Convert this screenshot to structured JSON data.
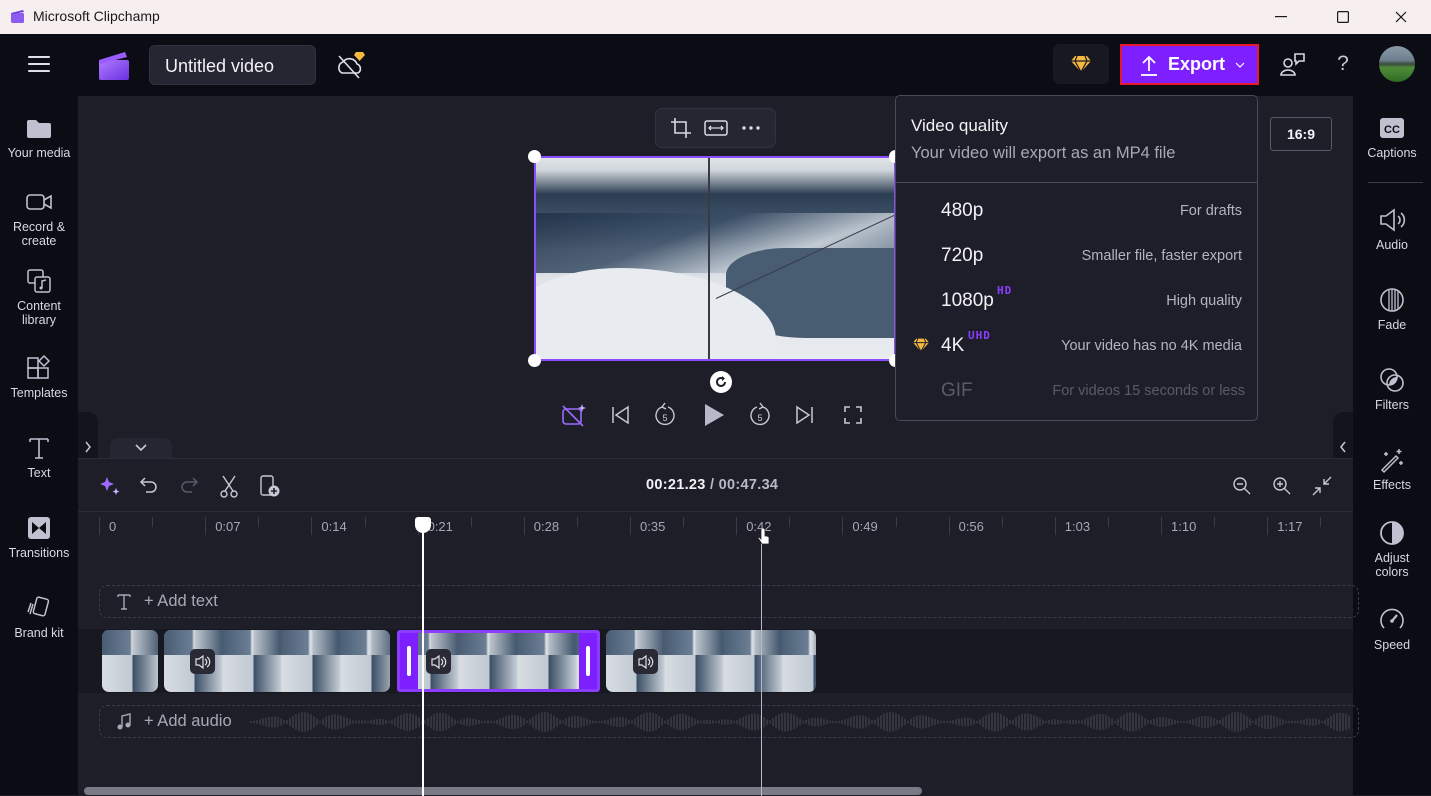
{
  "window": {
    "title": "Microsoft Clipchamp",
    "controls": [
      "minimize",
      "maximize",
      "close"
    ]
  },
  "header": {
    "menu_icon": "hamburger-icon",
    "project_title": "Untitled video",
    "sync_status_icon": "cloud-off-premium-icon",
    "premium_icon": "diamond-icon",
    "export_label": "Export",
    "share_icon": "share-feedback-icon",
    "help_label": "?",
    "avatar": "user-avatar"
  },
  "left_sidebar": {
    "items": [
      {
        "label": "Your media",
        "icon": "folder-icon"
      },
      {
        "label": "Record & create",
        "icon": "video-camera-icon"
      },
      {
        "label": "Content library",
        "icon": "content-library-icon"
      },
      {
        "label": "Templates",
        "icon": "templates-icon"
      },
      {
        "label": "Text",
        "icon": "text-icon"
      },
      {
        "label": "Transitions",
        "icon": "transitions-icon"
      },
      {
        "label": "Brand kit",
        "icon": "brand-kit-icon"
      }
    ]
  },
  "right_sidebar": {
    "items": [
      {
        "label": "Captions",
        "icon": "cc-icon"
      },
      {
        "label": "Audio",
        "icon": "speaker-icon"
      },
      {
        "label": "Fade",
        "icon": "fade-icon"
      },
      {
        "label": "Filters",
        "icon": "filters-icon"
      },
      {
        "label": "Effects",
        "icon": "magic-wand-icon"
      },
      {
        "label": "Adjust colors",
        "icon": "contrast-icon"
      },
      {
        "label": "Speed",
        "icon": "speedometer-icon"
      }
    ]
  },
  "stage": {
    "toolbar": [
      "crop-icon",
      "fit-icon",
      "more-icon"
    ],
    "aspect_ratio": "16:9",
    "playback": [
      "ai-camera-icon",
      "skip-back-icon",
      "rewind-5-icon",
      "play-icon",
      "forward-5-icon",
      "skip-forward-icon",
      "fullscreen-icon"
    ],
    "rewind_seconds": "5",
    "forward_seconds": "5"
  },
  "export_menu": {
    "title": "Video quality",
    "subtitle": "Your video will export as an MP4 file",
    "options": [
      {
        "label": "480p",
        "badge": "",
        "description": "For drafts",
        "premium": false,
        "disabled": false
      },
      {
        "label": "720p",
        "badge": "",
        "description": "Smaller file, faster export",
        "premium": false,
        "disabled": false
      },
      {
        "label": "1080p",
        "badge": "HD",
        "description": "High quality",
        "premium": false,
        "disabled": false
      },
      {
        "label": "4K",
        "badge": "UHD",
        "description": "Your video has no 4K media",
        "premium": true,
        "disabled": false
      },
      {
        "label": "GIF",
        "badge": "",
        "description": "For videos 15 seconds or less",
        "premium": false,
        "disabled": true
      }
    ]
  },
  "timeline": {
    "current_time": "00:21.23",
    "separator": " / ",
    "total_time": "00:47.34",
    "tools": [
      "magic-icon",
      "undo-icon",
      "redo-icon",
      "split-icon",
      "add-clip-icon"
    ],
    "zoom_tools": [
      "zoom-out-icon",
      "zoom-in-icon",
      "fit-timeline-icon"
    ],
    "ruler_labels": [
      "0",
      "0:07",
      "0:14",
      "0:21",
      "0:28",
      "0:35",
      "0:42",
      "0:49",
      "0:56",
      "1:03",
      "1:10",
      "1:17"
    ],
    "text_track_label": "+ Add text",
    "audio_track_label": "+ Add audio",
    "clips": [
      {
        "name": "clip-1",
        "has_audio": false,
        "selected": false
      },
      {
        "name": "clip-2",
        "has_audio": true,
        "selected": false
      },
      {
        "name": "clip-3",
        "has_audio": true,
        "selected": true
      },
      {
        "name": "clip-4",
        "has_audio": true,
        "selected": false
      }
    ]
  },
  "colors": {
    "accent": "#7d1fff",
    "selection": "#8b4dff",
    "export_border": "#e8192c",
    "premium_gold": "#f5b942",
    "badge": "#8b3dff"
  }
}
